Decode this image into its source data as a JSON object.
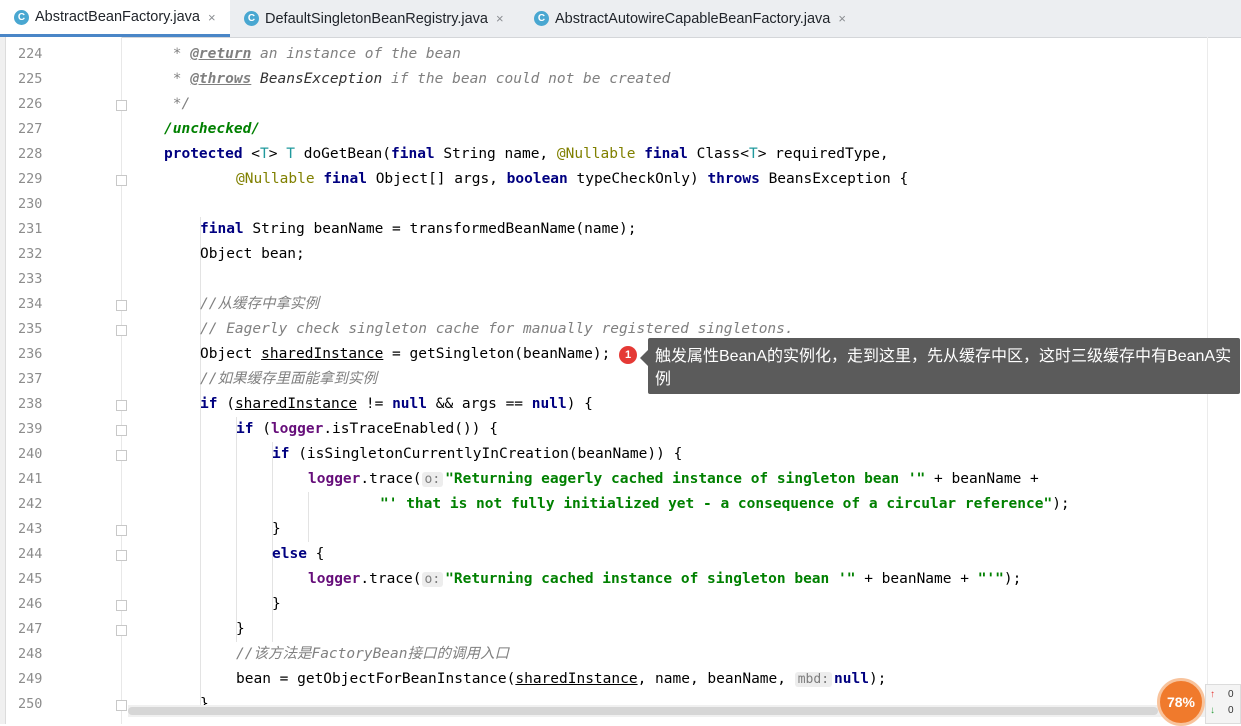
{
  "tabs": [
    {
      "label": "AbstractBeanFactory.java",
      "icon": "class-c-icon",
      "active": true
    },
    {
      "label": "DefaultSingletonBeanRegistry.java",
      "icon": "class-c-icon",
      "active": false
    },
    {
      "label": "AbstractAutowireCapableBeanFactory.java",
      "icon": "class-c-icon",
      "active": false
    }
  ],
  "tab_icon_letter": "C",
  "close_glyph": "×",
  "line_numbers": [
    "224",
    "225",
    "226",
    "227",
    "228",
    "229",
    "230",
    "231",
    "232",
    "233",
    "234",
    "235",
    "236",
    "237",
    "238",
    "239",
    "240",
    "241",
    "242",
    "243",
    "244",
    "245",
    "246",
    "247",
    "248",
    "249",
    "250"
  ],
  "code": {
    "l224_star": " * ",
    "l224_tag": "@return",
    "l224_rest": " an instance of the bean",
    "l225_star": " * ",
    "l225_tag": "@throws",
    "l225_rest1": " ",
    "l225_ex": "BeansException",
    "l225_rest2": " if the bean could not be created",
    "l226": " */",
    "l227": "/unchecked/",
    "l228_kw": "protected",
    "l228_a": " <",
    "l228_t1": "T",
    "l228_b": "> ",
    "l228_t2": "T",
    "l228_c": " doGetBean(",
    "l228_kw2": "final",
    "l228_d": " String name, ",
    "l228_ann": "@Nullable",
    "l228_e": " ",
    "l228_kw3": "final",
    "l228_f": " Class<",
    "l228_t3": "T",
    "l228_g": "> requiredType,",
    "l229_ann": "@Nullable",
    "l229_a": " ",
    "l229_kw": "final",
    "l229_b": " Object[] args, ",
    "l229_kw2": "boolean",
    "l229_c": " typeCheckOnly) ",
    "l229_kw3": "throws",
    "l229_d": " BeansException {",
    "l231_kw": "final",
    "l231_rest": " String beanName = transformedBeanName(name);",
    "l232": "Object bean;",
    "l234": "//从缓存中拿实例",
    "l235": "// Eagerly check singleton cache for manually registered singletons.",
    "l236_a": "Object ",
    "l236_var": "sharedInstance",
    "l236_b": " = getSingleton(beanName);",
    "l237": "//如果缓存里面能拿到实例",
    "l238_kw": "if",
    "l238_a": " (",
    "l238_var": "sharedInstance",
    "l238_b": " != ",
    "l238_kw2": "null",
    "l238_c": " && args == ",
    "l238_kw3": "null",
    "l238_d": ") {",
    "l239_kw": "if",
    "l239_a": " (",
    "l239_fld": "logger",
    "l239_b": ".isTraceEnabled()) {",
    "l240_kw": "if",
    "l240_a": " (isSingletonCurrentlyInCreation(beanName)) {",
    "l241_fld": "logger",
    "l241_a": ".trace(",
    "l241_hint": "o:",
    "l241_str": "\"Returning eagerly cached instance of singleton bean '\"",
    "l241_b": " + beanName +",
    "l242_str": "\"' that is not fully initialized yet - a consequence of a circular reference\"",
    "l242_b": ");",
    "l243": "}",
    "l244_kw": "else",
    "l244_a": " {",
    "l245_fld": "logger",
    "l245_a": ".trace(",
    "l245_hint": "o:",
    "l245_str": "\"Returning cached instance of singleton bean '\"",
    "l245_b": " + beanName + ",
    "l245_str2": "\"'\"",
    "l245_c": ");",
    "l246": "}",
    "l247": "}",
    "l248": "//该方法是FactoryBean接口的调用入口",
    "l249_a": "bean = getObjectForBeanInstance(",
    "l249_var": "sharedInstance",
    "l249_b": ", name, beanName, ",
    "l249_hint": "mbd:",
    "l249_kw": "null",
    "l249_c": ");",
    "l250": "}"
  },
  "annotation": {
    "badge": "1",
    "tooltip": "触发属性BeanA的实例化，走到这里，先从缓存中区，这时三级缓存中有BeanA实例"
  },
  "status": {
    "memory_percent": "78%",
    "up_arrow": "↑",
    "down_arrow": "↓",
    "up_value": "0",
    "down_value": "0"
  },
  "colors": {
    "keyword": "#000080",
    "comment": "#808080",
    "string": "#008000",
    "annotation": "#808000",
    "field": "#660e7a",
    "badge": "#e53935",
    "tab_underline": "#4a86c7"
  }
}
